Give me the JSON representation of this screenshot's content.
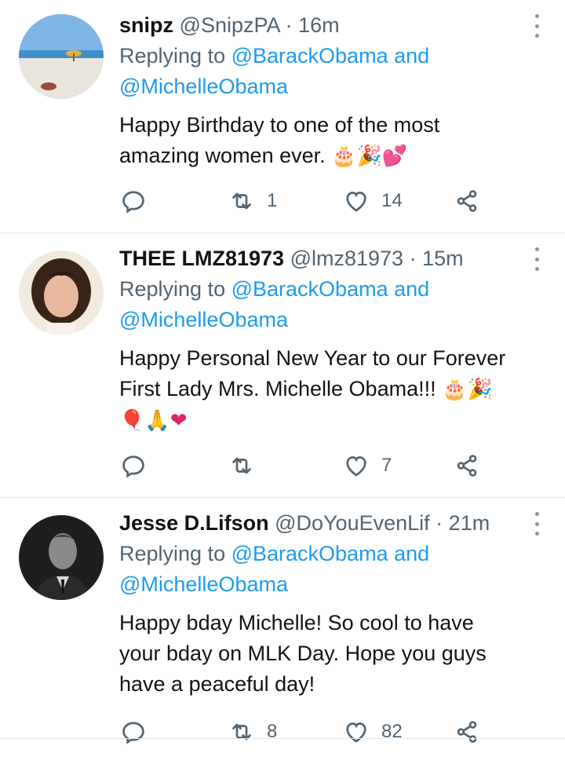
{
  "tweets": [
    {
      "name": "snipz",
      "handle": "@SnipzPA",
      "separator": "·",
      "time": "16m",
      "replying_prefix": "Replying to ",
      "replying_user1": "@BarackObama",
      "replying_and": " and",
      "replying_user2": "@MichelleObama",
      "text_line1": "Happy Birthday to one of the most",
      "text_line2": "amazing women ever.",
      "emojis_line2": "🎂🎉💕",
      "reply_count": "",
      "retweet_count": "1",
      "like_count": "14"
    },
    {
      "name": "THEE LMZ81973",
      "handle": "@lmz81973",
      "separator": "·",
      "time": "15m",
      "replying_prefix": "Replying to ",
      "replying_user1": "@BarackObama",
      "replying_and": " and",
      "replying_user2": "@MichelleObama",
      "text_line1": "Happy Personal New Year to our Forever",
      "text_line2": "First Lady Mrs. Michelle Obama!!!",
      "emojis_line2": "🎂🎉",
      "emojis_line3": "🎈🙏❤",
      "reply_count": "",
      "retweet_count": "",
      "like_count": "7"
    },
    {
      "name": "Jesse D.Lifson",
      "handle": "@DoYouEvenLif",
      "separator": "·",
      "time": "21m",
      "replying_prefix": "Replying to ",
      "replying_user1": "@BarackObama",
      "replying_and": " and",
      "replying_user2": "@MichelleObama",
      "text_line1": "Happy bday Michelle! So cool to have",
      "text_line2": "your bday on MLK Day. Hope you guys",
      "text_line3": "have a peaceful day!",
      "reply_count": "",
      "retweet_count": "8",
      "like_count": "82"
    }
  ],
  "icons": {
    "reply": "reply-icon",
    "retweet": "retweet-icon",
    "like": "heart-icon",
    "share": "share-icon",
    "more": "more-vertical-icon"
  },
  "colors": {
    "link": "#1d9bf0",
    "secondary": "#536471",
    "icon": "#536471",
    "divider": "#e1e8ed"
  }
}
